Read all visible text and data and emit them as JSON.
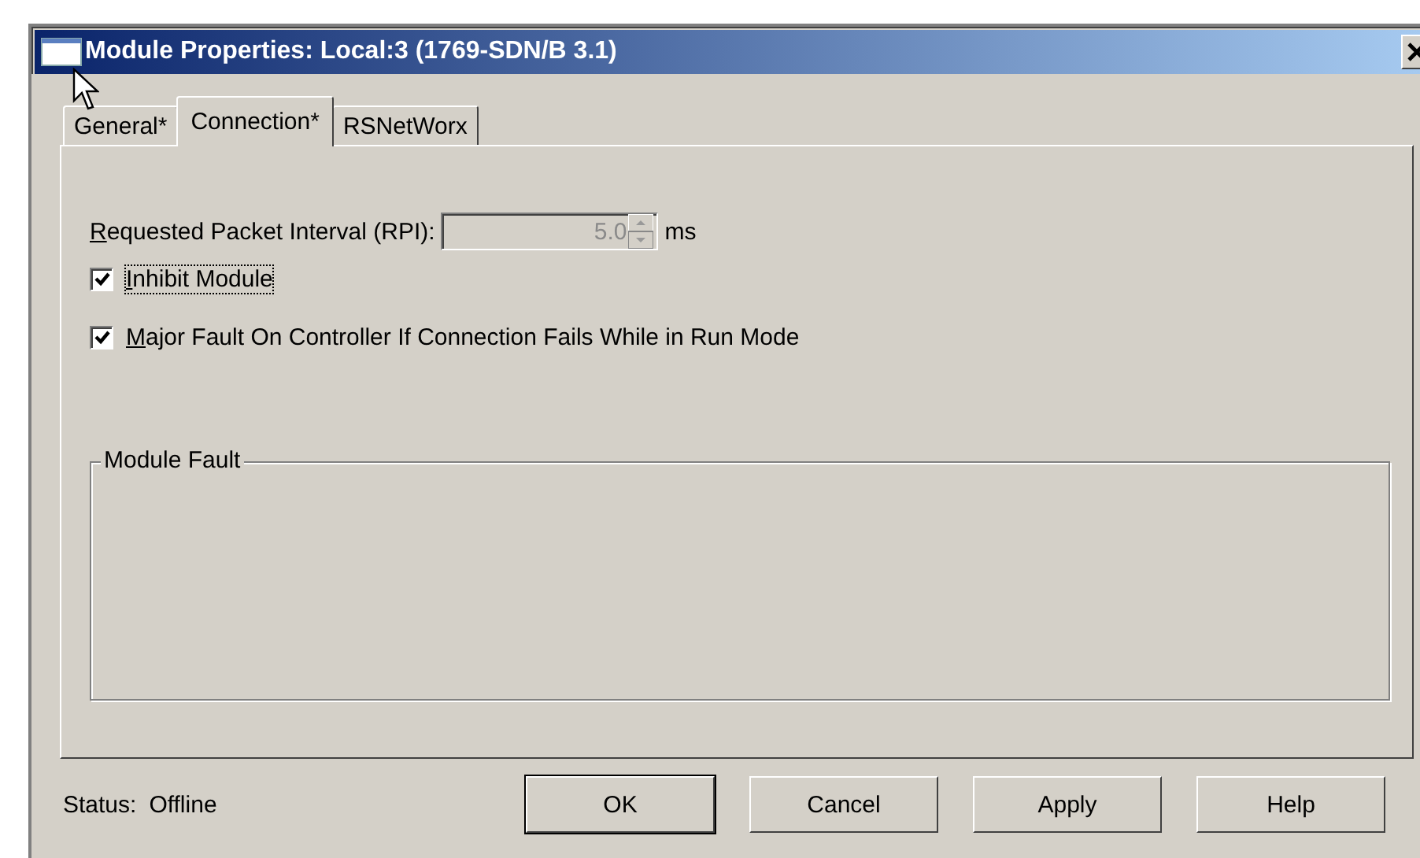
{
  "window": {
    "title": "Module Properties: Local:3 (1769-SDN/B 3.1)"
  },
  "tabs": [
    {
      "label": "General*",
      "selected": false
    },
    {
      "label": "Connection*",
      "selected": true
    },
    {
      "label": "RSNetWorx",
      "selected": false
    }
  ],
  "rpi": {
    "label": "Requested Packet Interval (RPI):",
    "value": "5.0",
    "unit": "ms",
    "disabled": true
  },
  "options": [
    {
      "label": "Inhibit Module",
      "checked": true,
      "focused": true
    },
    {
      "label": "Major Fault On Controller If Connection Fails While in Run Mode",
      "checked": true,
      "focused": false
    }
  ],
  "module_fault": {
    "title": "Module Fault"
  },
  "status": {
    "label": "Status:",
    "value": "Offline"
  },
  "buttons": [
    {
      "label": "OK",
      "default": true
    },
    {
      "label": "Cancel",
      "default": false
    },
    {
      "label": "Apply",
      "default": false
    },
    {
      "label": "Help",
      "default": false
    }
  ]
}
